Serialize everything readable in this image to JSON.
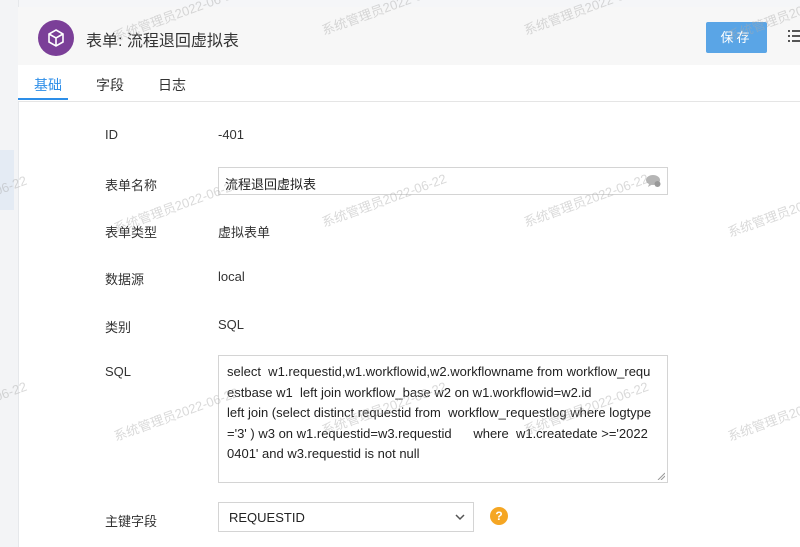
{
  "header": {
    "title": "表单: 流程退回虚拟表",
    "save_label": "保存"
  },
  "tabs": [
    {
      "label": "基础",
      "active": true
    },
    {
      "label": "字段",
      "active": false
    },
    {
      "label": "日志",
      "active": false
    }
  ],
  "form": {
    "id": {
      "label": "ID",
      "value": "-401"
    },
    "name": {
      "label": "表单名称",
      "value": "流程退回虚拟表"
    },
    "type": {
      "label": "表单类型",
      "value": "虚拟表单"
    },
    "datasource": {
      "label": "数据源",
      "value": "local"
    },
    "category": {
      "label": "类别",
      "value": "SQL"
    },
    "sql": {
      "label": "SQL",
      "value": "select  w1.requestid,w1.workflowid,w2.workflowname from workflow_requestbase w1  left join workflow_base w2 on w1.workflowid=w2.id\nleft join (select distinct requestid from  workflow_requestlog where logtype='3' ) w3 on w1.requestid=w3.requestid      where  w1.createdate >='20220401' and w3.requestid is not null"
    },
    "primary_key": {
      "label": "主键字段",
      "value": "REQUESTID"
    }
  },
  "watermark": {
    "text": "系统管理员2022-06-22",
    "date_fragment": "06-22"
  },
  "colors": {
    "accent": "#2d8ee8",
    "save_button": "#5aa5e6",
    "app_icon": "#7b3f98",
    "help_icon": "#f5a623"
  },
  "icons": {
    "app": "cube-icon",
    "menu": "list-menu-icon",
    "input_addon": "chat-bubble-icon",
    "dropdown": "chevron-down-icon",
    "help": "question-icon"
  }
}
